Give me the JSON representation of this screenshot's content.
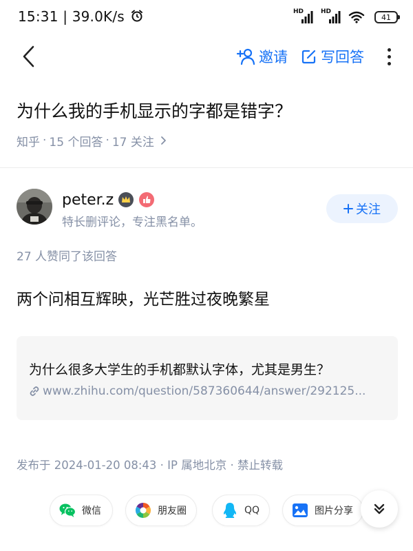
{
  "status_bar": {
    "time": "15:31",
    "network_speed": "39.0K/s",
    "signal_labels": [
      "HD",
      "HD"
    ],
    "battery_level": "41",
    "icons": [
      "alarm-clock-icon",
      "signal-icon",
      "wifi-icon",
      "battery-icon"
    ]
  },
  "nav": {
    "back_icon": "chevron-left-icon",
    "invite_label": "邀请",
    "write_answer_label": "写回答",
    "more_icon": "more-vertical-icon"
  },
  "question": {
    "title": "为什么我的手机显示的字都是错字？",
    "source": "知乎",
    "answer_count": "15 个回答",
    "follower_count": "17 关注",
    "separator": "·"
  },
  "author": {
    "name": "peter.z",
    "bio": "特长删评论，专注黑名单。",
    "follow_label": "关注"
  },
  "answer": {
    "votes_text": "27 人赞同了该回答",
    "content": "两个问相互辉映，光芒胜过夜晚繁星",
    "link_card": {
      "title": "为什么很多大学生的手机都默认字体，尤其是男生？",
      "url": "www.zhihu.com/question/587360644/answer/292125..."
    },
    "publish_info": "发布于 2024-01-20 08:43 · IP 属地北京 · 禁止转载"
  },
  "share_bar": {
    "wechat_label": "微信",
    "moments_label": "朋友圈",
    "qq_label": "QQ",
    "image_share_label": "图片分享"
  },
  "colors": {
    "accent": "#1772f6",
    "meta_gray": "#8590a6",
    "follow_bg": "#ecf3fe",
    "card_bg": "#f6f6f6",
    "wechat_green": "#07c160",
    "qq_blue": "#12b7f5"
  }
}
